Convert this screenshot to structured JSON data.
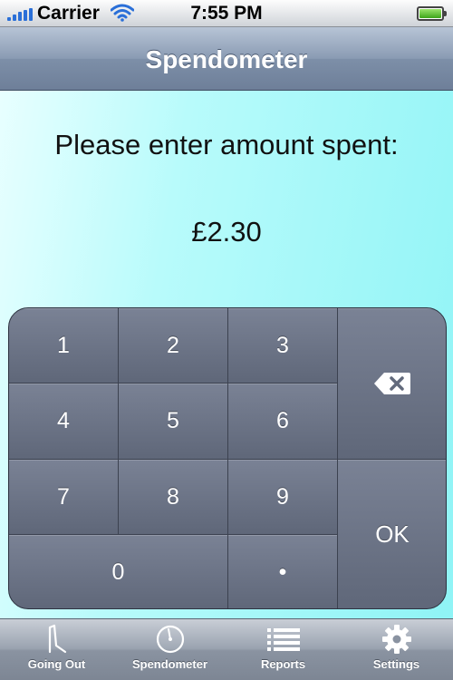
{
  "status_bar": {
    "carrier": "Carrier",
    "time": "7:55 PM"
  },
  "nav_bar": {
    "title": "Spendometer"
  },
  "main": {
    "prompt": "Please enter amount spent:",
    "amount": "£2.30"
  },
  "keypad": {
    "keys": [
      "1",
      "2",
      "3",
      "4",
      "5",
      "6",
      "7",
      "8",
      "9",
      "0",
      "•"
    ],
    "ok_label": "OK"
  },
  "tab_bar": {
    "tabs": [
      {
        "label": "Going Out",
        "icon": "walking-person-icon"
      },
      {
        "label": "Spendometer",
        "icon": "gauge-icon"
      },
      {
        "label": "Reports",
        "icon": "list-icon"
      },
      {
        "label": "Settings",
        "icon": "gear-icon"
      }
    ]
  }
}
